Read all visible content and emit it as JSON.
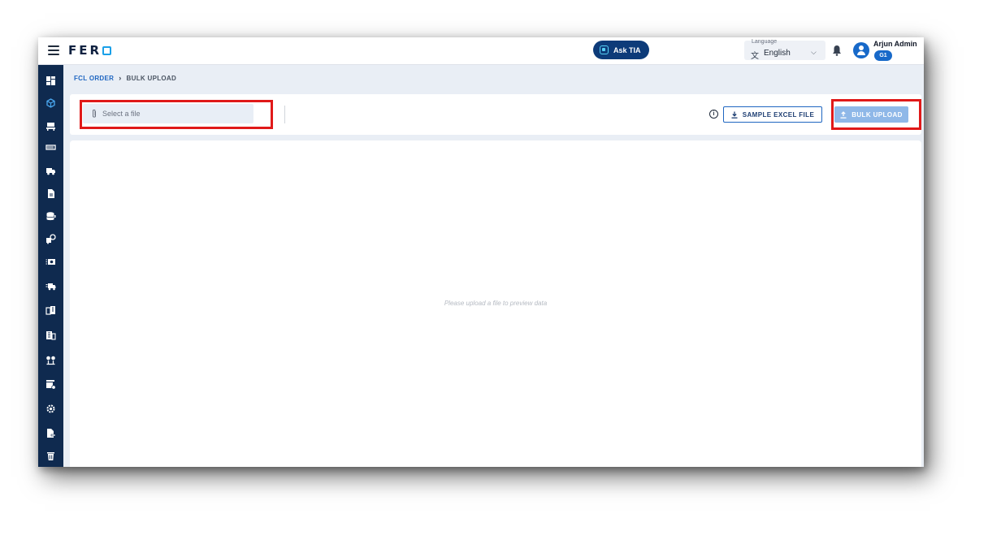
{
  "app": {
    "logo_text": "FER",
    "ask_button": "Ask TIA"
  },
  "language": {
    "label": "Language",
    "value": "English"
  },
  "user": {
    "name": "Arjun Admin",
    "badge": "G1"
  },
  "breadcrumb": {
    "parent": "FCL ORDER",
    "current": "BULK UPLOAD"
  },
  "toolbar": {
    "file_placeholder": "Select a file",
    "sample_label": "SAMPLE EXCEL FILE",
    "upload_label": "BULK UPLOAD"
  },
  "preview": {
    "empty_message": "Please upload a file to preview data"
  },
  "colors": {
    "sidebar": "#0f2a4f",
    "accent": "#1f66c1",
    "highlight": "#e01919"
  },
  "sidebar_icons": [
    "dashboard-icon",
    "orders-icon",
    "desk-icon",
    "rail-icon",
    "truck-icon",
    "document-icon",
    "database-icon",
    "route-icon",
    "cash-icon",
    "delivery-icon",
    "warehouse-icon",
    "building-icon",
    "location-icon",
    "inventory-icon",
    "settings-icon",
    "report-icon",
    "delete-icon"
  ]
}
